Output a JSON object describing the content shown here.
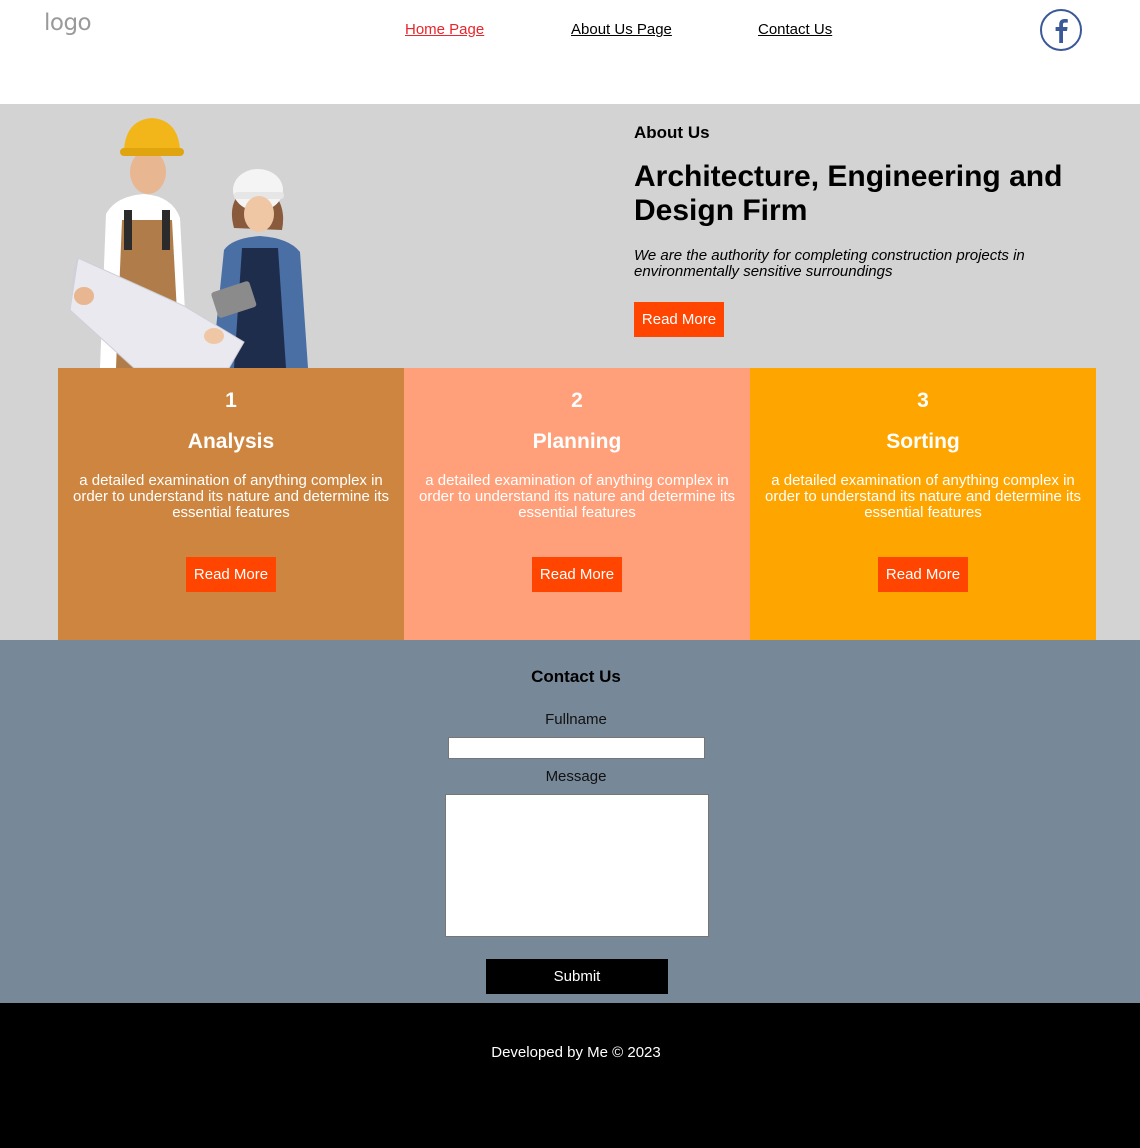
{
  "header": {
    "logo_text": "logo",
    "nav": [
      {
        "label": "Home Page",
        "active": true
      },
      {
        "label": "About Us Page",
        "active": false
      },
      {
        "label": "Contact Us",
        "active": false
      }
    ],
    "social_icon": "facebook-icon"
  },
  "hero": {
    "image": "construction-workers-image",
    "eyebrow": "About Us",
    "title": "Architecture, Engineering and Design Firm",
    "text": "We are the authority for completing construction projects in environmentally sensitive surroundings",
    "button_label": "Read More"
  },
  "steps": [
    {
      "number": "1",
      "title": "Analysis",
      "text": "a detailed examination of anything complex in order to understand its nature and determine its essential features",
      "button_label": "Read More",
      "color": "#cd853f"
    },
    {
      "number": "2",
      "title": "Planning",
      "text": "a detailed examination of anything complex in order to understand its nature and determine its essential features",
      "button_label": "Read More",
      "color": "#ffa07a"
    },
    {
      "number": "3",
      "title": "Sorting",
      "text": "a detailed examination of anything complex in order to understand its nature and determine its essential features",
      "button_label": "Read More",
      "color": "#ffa500"
    }
  ],
  "contact": {
    "title": "Contact Us",
    "fullname_label": "Fullname",
    "fullname_value": "",
    "message_label": "Message",
    "message_value": "",
    "submit_label": "Submit"
  },
  "footer": {
    "text": "Developed by Me © 2023"
  },
  "colors": {
    "accent": "#ff4500",
    "hero_bg": "#d3d3d3",
    "contact_bg": "#778899",
    "footer_bg": "#000000",
    "active_link": "#e8262b"
  }
}
